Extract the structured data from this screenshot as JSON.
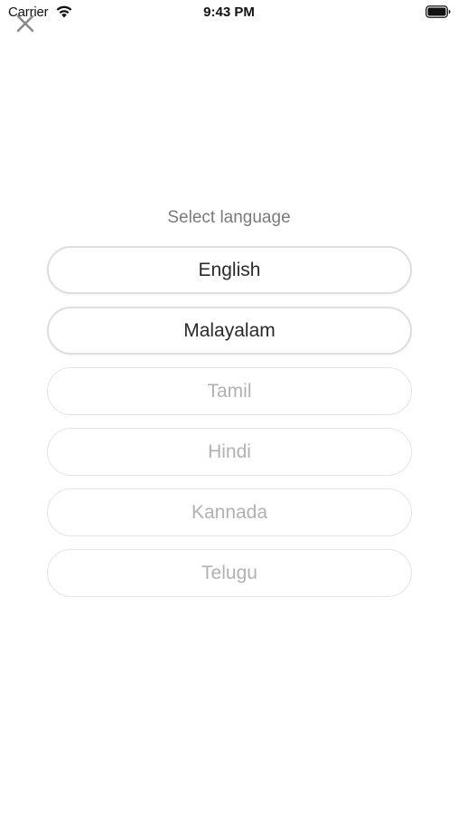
{
  "status_bar": {
    "carrier": "Carrier",
    "time": "9:43 PM"
  },
  "close": {
    "icon": "close-icon"
  },
  "screen": {
    "title": "Select language"
  },
  "languages": [
    {
      "label": "English",
      "active": true
    },
    {
      "label": "Malayalam",
      "active": true
    },
    {
      "label": "Tamil",
      "active": false
    },
    {
      "label": "Hindi",
      "active": false
    },
    {
      "label": "Kannada",
      "active": false
    },
    {
      "label": "Telugu",
      "active": false
    }
  ],
  "colors": {
    "active_text": "#2a2a2a",
    "inactive_text": "#b1b1b1",
    "border": "#e4e4e4",
    "title": "#7a7a7a"
  }
}
